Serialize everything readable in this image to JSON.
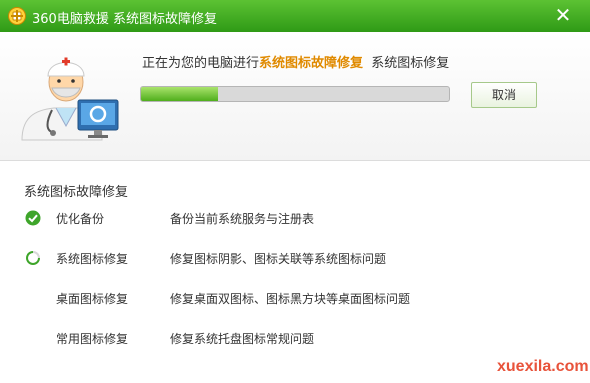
{
  "window": {
    "title": "360电脑救援  系统图标故障修复"
  },
  "status": {
    "prefix": "正在为您的电脑进行",
    "highlight": "系统图标故障修复",
    "suffix": "系统图标修复"
  },
  "progress": {
    "value": 0.25
  },
  "buttons": {
    "cancel_label": "取消"
  },
  "section": {
    "title": "系统图标故障修复",
    "items": [
      {
        "name": "优化备份",
        "desc": "备份当前系统服务与注册表",
        "state": "done"
      },
      {
        "name": "系统图标修复",
        "desc": "修复图标阴影、图标关联等系统图标问题",
        "state": "running"
      },
      {
        "name": "桌面图标修复",
        "desc": "修复桌面双图标、图标黑方块等桌面图标问题",
        "state": "pending"
      },
      {
        "name": "常用图标修复",
        "desc": "修复系统托盘图标常规问题",
        "state": "pending"
      }
    ]
  },
  "watermark": "xuexila.com",
  "colors": {
    "titlebar": "#3aa61c",
    "accent": "#e08a00",
    "check": "#3ea52a"
  }
}
